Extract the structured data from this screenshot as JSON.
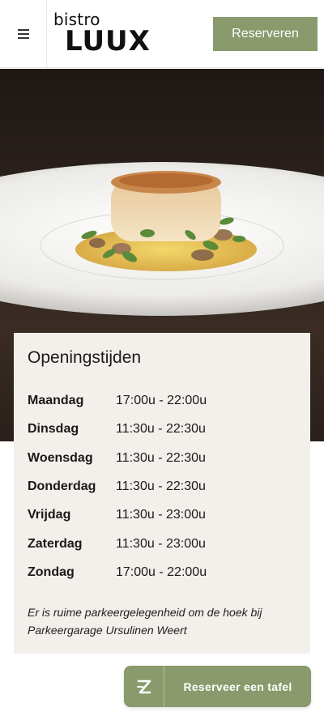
{
  "header": {
    "menu_icon": "hamburger-menu-icon",
    "logo_small": "bistro",
    "logo_big": "LUUX",
    "reserve_label": "Reserveren"
  },
  "hero": {
    "image": "scallop-dish-photo"
  },
  "hours": {
    "title": "Openingstijden",
    "rows": [
      {
        "day": "Maandag",
        "time": "17:00u - 22:00u"
      },
      {
        "day": "Dinsdag",
        "time": "11:30u - 22:30u"
      },
      {
        "day": "Woensdag",
        "time": "11:30u - 22:30u"
      },
      {
        "day": "Donderdag",
        "time": "11:30u - 22:30u"
      },
      {
        "day": "Vrijdag",
        "time": "11:30u - 23:00u"
      },
      {
        "day": "Zaterdag",
        "time": "11:30u - 23:00u"
      },
      {
        "day": "Zondag",
        "time": "17:00u - 22:00u"
      }
    ],
    "note": "Er is ruime parkeergelegenheid om de hoek bij Parkeergarage Ursulinen Weert"
  },
  "cta": {
    "icon": "zenchef-z-icon",
    "label": "Reserveer een tafel"
  },
  "colors": {
    "accent": "#8a9a6c",
    "card_bg": "#f3efea"
  }
}
